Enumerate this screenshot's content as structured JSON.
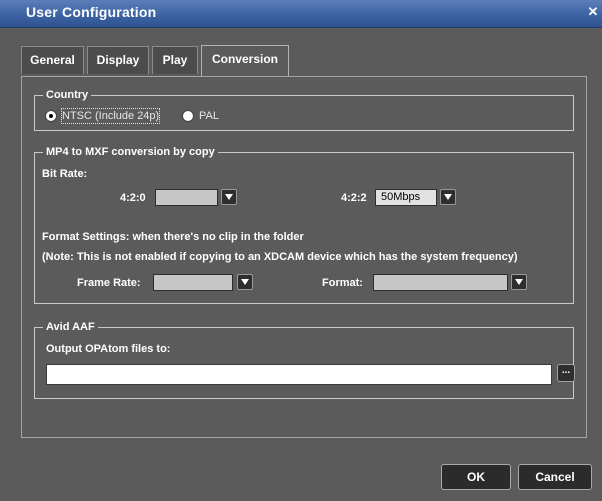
{
  "window": {
    "title": "User Configuration",
    "close_glyph": "✕"
  },
  "tabs": [
    {
      "label": "General"
    },
    {
      "label": "Display"
    },
    {
      "label": "Play"
    },
    {
      "label": "Conversion",
      "active": true
    }
  ],
  "country": {
    "legend": "Country",
    "options": [
      {
        "label": "NTSC (Include 24p)",
        "selected": true
      },
      {
        "label": "PAL",
        "selected": false
      }
    ]
  },
  "mp4": {
    "legend": "MP4 to MXF conversion by copy",
    "bitrate_label": "Bit Rate:",
    "label_420": "4:2:0",
    "value_420": "",
    "label_422": "4:2:2",
    "value_422": "50Mbps",
    "format_settings_label": "Format Settings: when there's no clip in the folder",
    "note": "(Note: This is not enabled if copying to an XDCAM device which has the system frequency)",
    "frame_rate_label": "Frame Rate:",
    "frame_rate_value": "",
    "format_label": "Format:",
    "format_value": ""
  },
  "avid": {
    "legend": "Avid AAF",
    "output_label": "Output OPAtom files to:",
    "output_value": "",
    "browse_label": "..."
  },
  "buttons": {
    "ok": "OK",
    "cancel": "Cancel"
  },
  "colors": {
    "titlebar": "#3d63a3",
    "background": "#5b5b5b",
    "text": "#ffffff"
  }
}
